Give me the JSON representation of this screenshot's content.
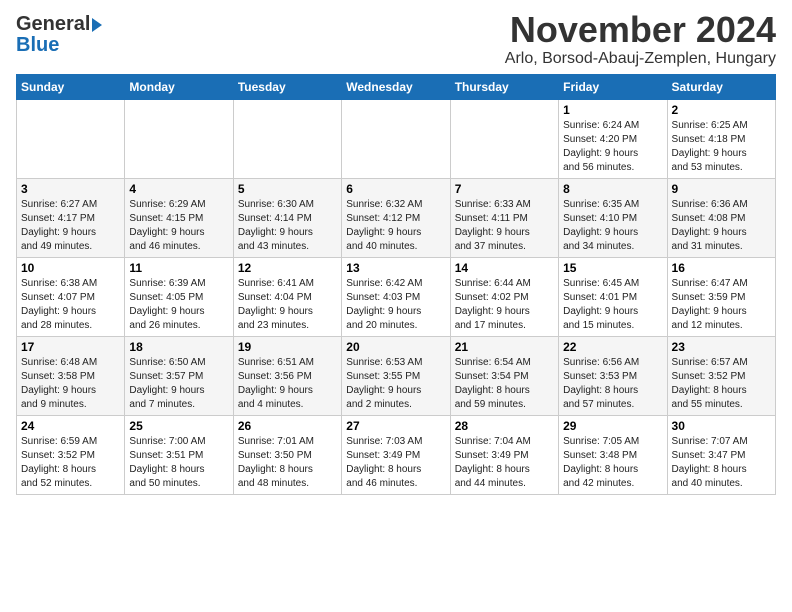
{
  "header": {
    "logo_line1": "General",
    "logo_line2": "Blue",
    "month": "November 2024",
    "location": "Arlo, Borsod-Abauj-Zemplen, Hungary"
  },
  "days_of_week": [
    "Sunday",
    "Monday",
    "Tuesday",
    "Wednesday",
    "Thursday",
    "Friday",
    "Saturday"
  ],
  "weeks": [
    [
      {
        "day": "",
        "info": ""
      },
      {
        "day": "",
        "info": ""
      },
      {
        "day": "",
        "info": ""
      },
      {
        "day": "",
        "info": ""
      },
      {
        "day": "",
        "info": ""
      },
      {
        "day": "1",
        "info": "Sunrise: 6:24 AM\nSunset: 4:20 PM\nDaylight: 9 hours\nand 56 minutes."
      },
      {
        "day": "2",
        "info": "Sunrise: 6:25 AM\nSunset: 4:18 PM\nDaylight: 9 hours\nand 53 minutes."
      }
    ],
    [
      {
        "day": "3",
        "info": "Sunrise: 6:27 AM\nSunset: 4:17 PM\nDaylight: 9 hours\nand 49 minutes."
      },
      {
        "day": "4",
        "info": "Sunrise: 6:29 AM\nSunset: 4:15 PM\nDaylight: 9 hours\nand 46 minutes."
      },
      {
        "day": "5",
        "info": "Sunrise: 6:30 AM\nSunset: 4:14 PM\nDaylight: 9 hours\nand 43 minutes."
      },
      {
        "day": "6",
        "info": "Sunrise: 6:32 AM\nSunset: 4:12 PM\nDaylight: 9 hours\nand 40 minutes."
      },
      {
        "day": "7",
        "info": "Sunrise: 6:33 AM\nSunset: 4:11 PM\nDaylight: 9 hours\nand 37 minutes."
      },
      {
        "day": "8",
        "info": "Sunrise: 6:35 AM\nSunset: 4:10 PM\nDaylight: 9 hours\nand 34 minutes."
      },
      {
        "day": "9",
        "info": "Sunrise: 6:36 AM\nSunset: 4:08 PM\nDaylight: 9 hours\nand 31 minutes."
      }
    ],
    [
      {
        "day": "10",
        "info": "Sunrise: 6:38 AM\nSunset: 4:07 PM\nDaylight: 9 hours\nand 28 minutes."
      },
      {
        "day": "11",
        "info": "Sunrise: 6:39 AM\nSunset: 4:05 PM\nDaylight: 9 hours\nand 26 minutes."
      },
      {
        "day": "12",
        "info": "Sunrise: 6:41 AM\nSunset: 4:04 PM\nDaylight: 9 hours\nand 23 minutes."
      },
      {
        "day": "13",
        "info": "Sunrise: 6:42 AM\nSunset: 4:03 PM\nDaylight: 9 hours\nand 20 minutes."
      },
      {
        "day": "14",
        "info": "Sunrise: 6:44 AM\nSunset: 4:02 PM\nDaylight: 9 hours\nand 17 minutes."
      },
      {
        "day": "15",
        "info": "Sunrise: 6:45 AM\nSunset: 4:01 PM\nDaylight: 9 hours\nand 15 minutes."
      },
      {
        "day": "16",
        "info": "Sunrise: 6:47 AM\nSunset: 3:59 PM\nDaylight: 9 hours\nand 12 minutes."
      }
    ],
    [
      {
        "day": "17",
        "info": "Sunrise: 6:48 AM\nSunset: 3:58 PM\nDaylight: 9 hours\nand 9 minutes."
      },
      {
        "day": "18",
        "info": "Sunrise: 6:50 AM\nSunset: 3:57 PM\nDaylight: 9 hours\nand 7 minutes."
      },
      {
        "day": "19",
        "info": "Sunrise: 6:51 AM\nSunset: 3:56 PM\nDaylight: 9 hours\nand 4 minutes."
      },
      {
        "day": "20",
        "info": "Sunrise: 6:53 AM\nSunset: 3:55 PM\nDaylight: 9 hours\nand 2 minutes."
      },
      {
        "day": "21",
        "info": "Sunrise: 6:54 AM\nSunset: 3:54 PM\nDaylight: 8 hours\nand 59 minutes."
      },
      {
        "day": "22",
        "info": "Sunrise: 6:56 AM\nSunset: 3:53 PM\nDaylight: 8 hours\nand 57 minutes."
      },
      {
        "day": "23",
        "info": "Sunrise: 6:57 AM\nSunset: 3:52 PM\nDaylight: 8 hours\nand 55 minutes."
      }
    ],
    [
      {
        "day": "24",
        "info": "Sunrise: 6:59 AM\nSunset: 3:52 PM\nDaylight: 8 hours\nand 52 minutes."
      },
      {
        "day": "25",
        "info": "Sunrise: 7:00 AM\nSunset: 3:51 PM\nDaylight: 8 hours\nand 50 minutes."
      },
      {
        "day": "26",
        "info": "Sunrise: 7:01 AM\nSunset: 3:50 PM\nDaylight: 8 hours\nand 48 minutes."
      },
      {
        "day": "27",
        "info": "Sunrise: 7:03 AM\nSunset: 3:49 PM\nDaylight: 8 hours\nand 46 minutes."
      },
      {
        "day": "28",
        "info": "Sunrise: 7:04 AM\nSunset: 3:49 PM\nDaylight: 8 hours\nand 44 minutes."
      },
      {
        "day": "29",
        "info": "Sunrise: 7:05 AM\nSunset: 3:48 PM\nDaylight: 8 hours\nand 42 minutes."
      },
      {
        "day": "30",
        "info": "Sunrise: 7:07 AM\nSunset: 3:47 PM\nDaylight: 8 hours\nand 40 minutes."
      }
    ]
  ]
}
